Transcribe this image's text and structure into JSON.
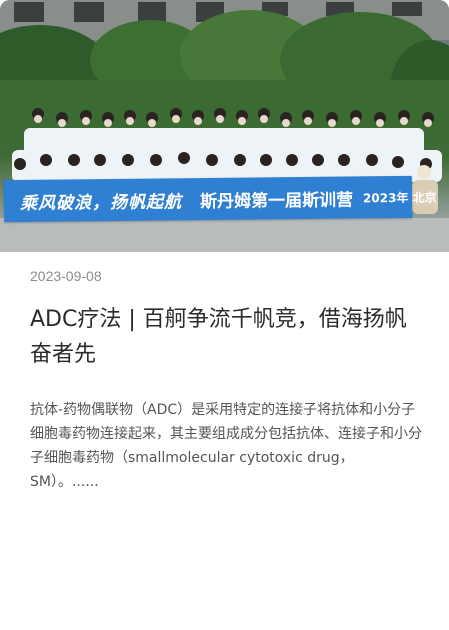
{
  "article": {
    "image": {
      "alt": "group-photo",
      "banner": {
        "slogan": "乘风破浪，扬帆起航",
        "camp": "斯丹姆第一届斯训营",
        "year_place": "2023年 北京"
      }
    },
    "date": "2023-09-08",
    "title": "ADC疗法 | 百舸争流千帆竞，借海扬帆奋者先",
    "summary": "抗体-药物偶联物（ADC）是采用特定的连接子将抗体和小分子细胞毒药物连接起来，其主要组成成分包括抗体、连接子和小分子细胞毒药物（smallmolecular cytotoxic drug，SM）。......"
  },
  "colors": {
    "banner": "#2f7fd2",
    "shirts": "#eef3f7",
    "foliage": "#3e6a34",
    "date_text": "#8c8c8c",
    "title_text": "#2b2b2b",
    "summary_text": "#555555"
  }
}
